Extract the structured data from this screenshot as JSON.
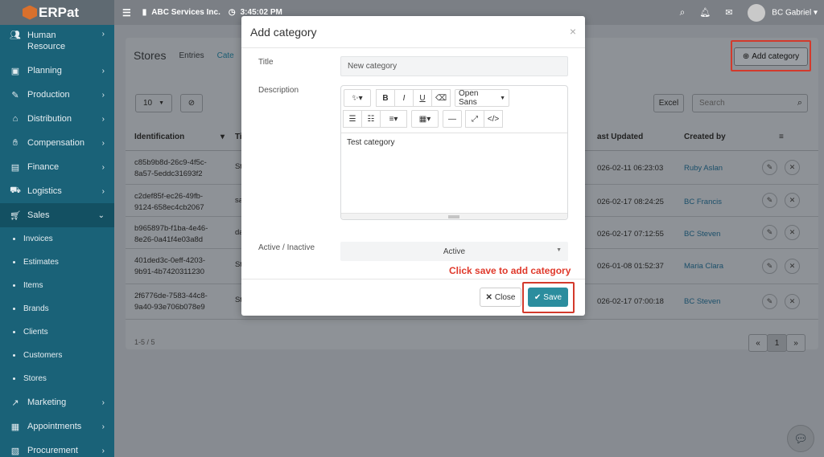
{
  "topbar": {
    "brand": "ERPat",
    "company": "ABC Services Inc.",
    "clock": "3:45:02 PM",
    "user": "BC Gabriel"
  },
  "sidebar": {
    "items": [
      {
        "label": "Human Resource",
        "icon": "users-icon"
      },
      {
        "label": "Planning",
        "icon": "briefcase-icon"
      },
      {
        "label": "Production",
        "icon": "wrench-icon"
      },
      {
        "label": "Distribution",
        "icon": "bank-icon"
      },
      {
        "label": "Compensation",
        "icon": "handshake-icon"
      },
      {
        "label": "Finance",
        "icon": "money-icon"
      },
      {
        "label": "Logistics",
        "icon": "truck-icon"
      },
      {
        "label": "Sales",
        "icon": "cart-icon"
      }
    ],
    "sales_sub": [
      "Invoices",
      "Estimates",
      "Items",
      "Brands",
      "Clients",
      "Customers",
      "Stores"
    ],
    "after": [
      {
        "label": "Marketing",
        "icon": "chart-icon"
      },
      {
        "label": "Appointments",
        "icon": "calendar-icon"
      },
      {
        "label": "Procurement",
        "icon": "box-icon"
      }
    ]
  },
  "page": {
    "title": "Stores",
    "tabs": [
      "Entries",
      "Cate"
    ],
    "add_label": "Add category",
    "page_size": "10",
    "excel": "Excel",
    "search_placeholder": "Search",
    "columns": {
      "identification": "Identification",
      "title": "Ti",
      "updated": "ast Updated",
      "created": "Created by"
    },
    "rows": [
      {
        "id": "c85b9b8d-26c9-4f5c-8a57-5eddc31693f2",
        "title": "St",
        "updated": "026-02-11 06:23:03",
        "by": "Ruby Aslan"
      },
      {
        "id": "c2def85f-ec26-49fb-9124-658ec4cb2067",
        "title": "sa",
        "updated": "026-02-17 08:24:25",
        "by": "BC Francis"
      },
      {
        "id": "b965897b-f1ba-4e46-8e26-0a41f4e03a8d",
        "title": "da",
        "updated": "026-02-17 07:12:55",
        "by": "BC Steven"
      },
      {
        "id": "401ded3c-0eff-4203-9b91-4b7420311230",
        "title": "St",
        "updated": "026-01-08 01:52:37",
        "by": "Maria Clara"
      },
      {
        "id": "2f6776de-7583-44c8-9a40-93e706b078e9",
        "title": "St",
        "updated": "026-02-17 07:00:18",
        "by": "BC Steven"
      }
    ],
    "range": "1-5 / 5",
    "current_page": "1"
  },
  "modal": {
    "title": "Add category",
    "title_label": "Title",
    "title_placeholder": "New category",
    "description_label": "Description",
    "font_name": "Open Sans",
    "description_text": "Test category",
    "status_label": "Active / Inactive",
    "status_value": "Active",
    "hint": "Click save to add category",
    "close_label": "Close",
    "save_label": "Save"
  }
}
